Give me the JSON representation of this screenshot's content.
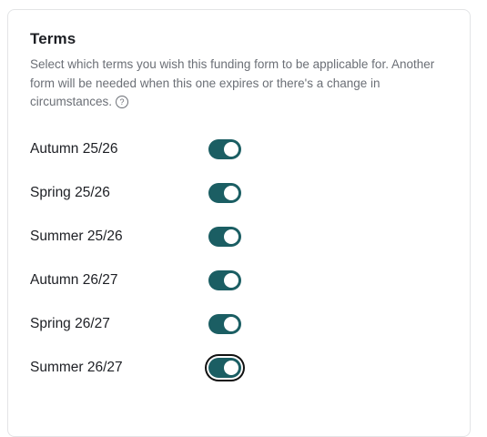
{
  "terms_section": {
    "title": "Terms",
    "description": "Select which terms you wish this funding form to be applicable for. Another form will be needed when this one expires or there's a change in circumstances.",
    "help_icon": "question-circle-icon",
    "help_glyph": "?"
  },
  "terms": [
    {
      "label": "Autumn 25/26",
      "enabled": true
    },
    {
      "label": "Spring 25/26",
      "enabled": true
    },
    {
      "label": "Summer 25/26",
      "enabled": true
    },
    {
      "label": "Autumn 26/27",
      "enabled": true
    },
    {
      "label": "Spring 26/27",
      "enabled": true
    },
    {
      "label": "Summer 26/27",
      "enabled": true,
      "focused": true
    }
  ],
  "colors": {
    "toggle_on": "#1b5e63",
    "title": "#1d1f24",
    "description": "#6b6f76"
  }
}
